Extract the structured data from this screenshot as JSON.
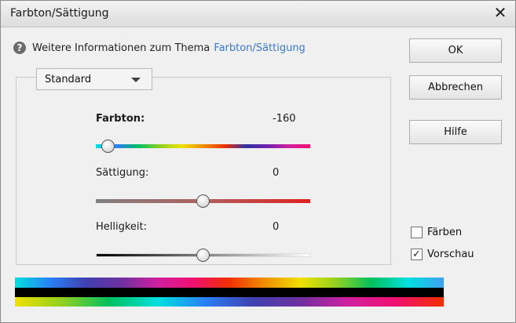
{
  "window": {
    "title": "Farbton/Sättigung",
    "close_glyph": "✕"
  },
  "info": {
    "icon": "help-icon",
    "text": "Weitere Informationen zum Thema",
    "link": "Farbton/Sättigung"
  },
  "preset": {
    "selected": "Standard"
  },
  "sliders": {
    "hue": {
      "label": "Farbton:",
      "value": "-160",
      "min": -180,
      "max": 180
    },
    "saturation": {
      "label": "Sättigung:",
      "value": "0",
      "min": -100,
      "max": 100
    },
    "lightness": {
      "label": "Helligkeit:",
      "value": "0",
      "min": -100,
      "max": 100
    }
  },
  "buttons": {
    "ok": "OK",
    "cancel": "Abbrechen",
    "help": "Hilfe"
  },
  "options": {
    "colorize": {
      "label": "Färben",
      "checked": false
    },
    "preview": {
      "label": "Vorschau",
      "checked": true
    }
  },
  "colors": {
    "link": "#3b78c8",
    "background": "#f0f0f0"
  }
}
